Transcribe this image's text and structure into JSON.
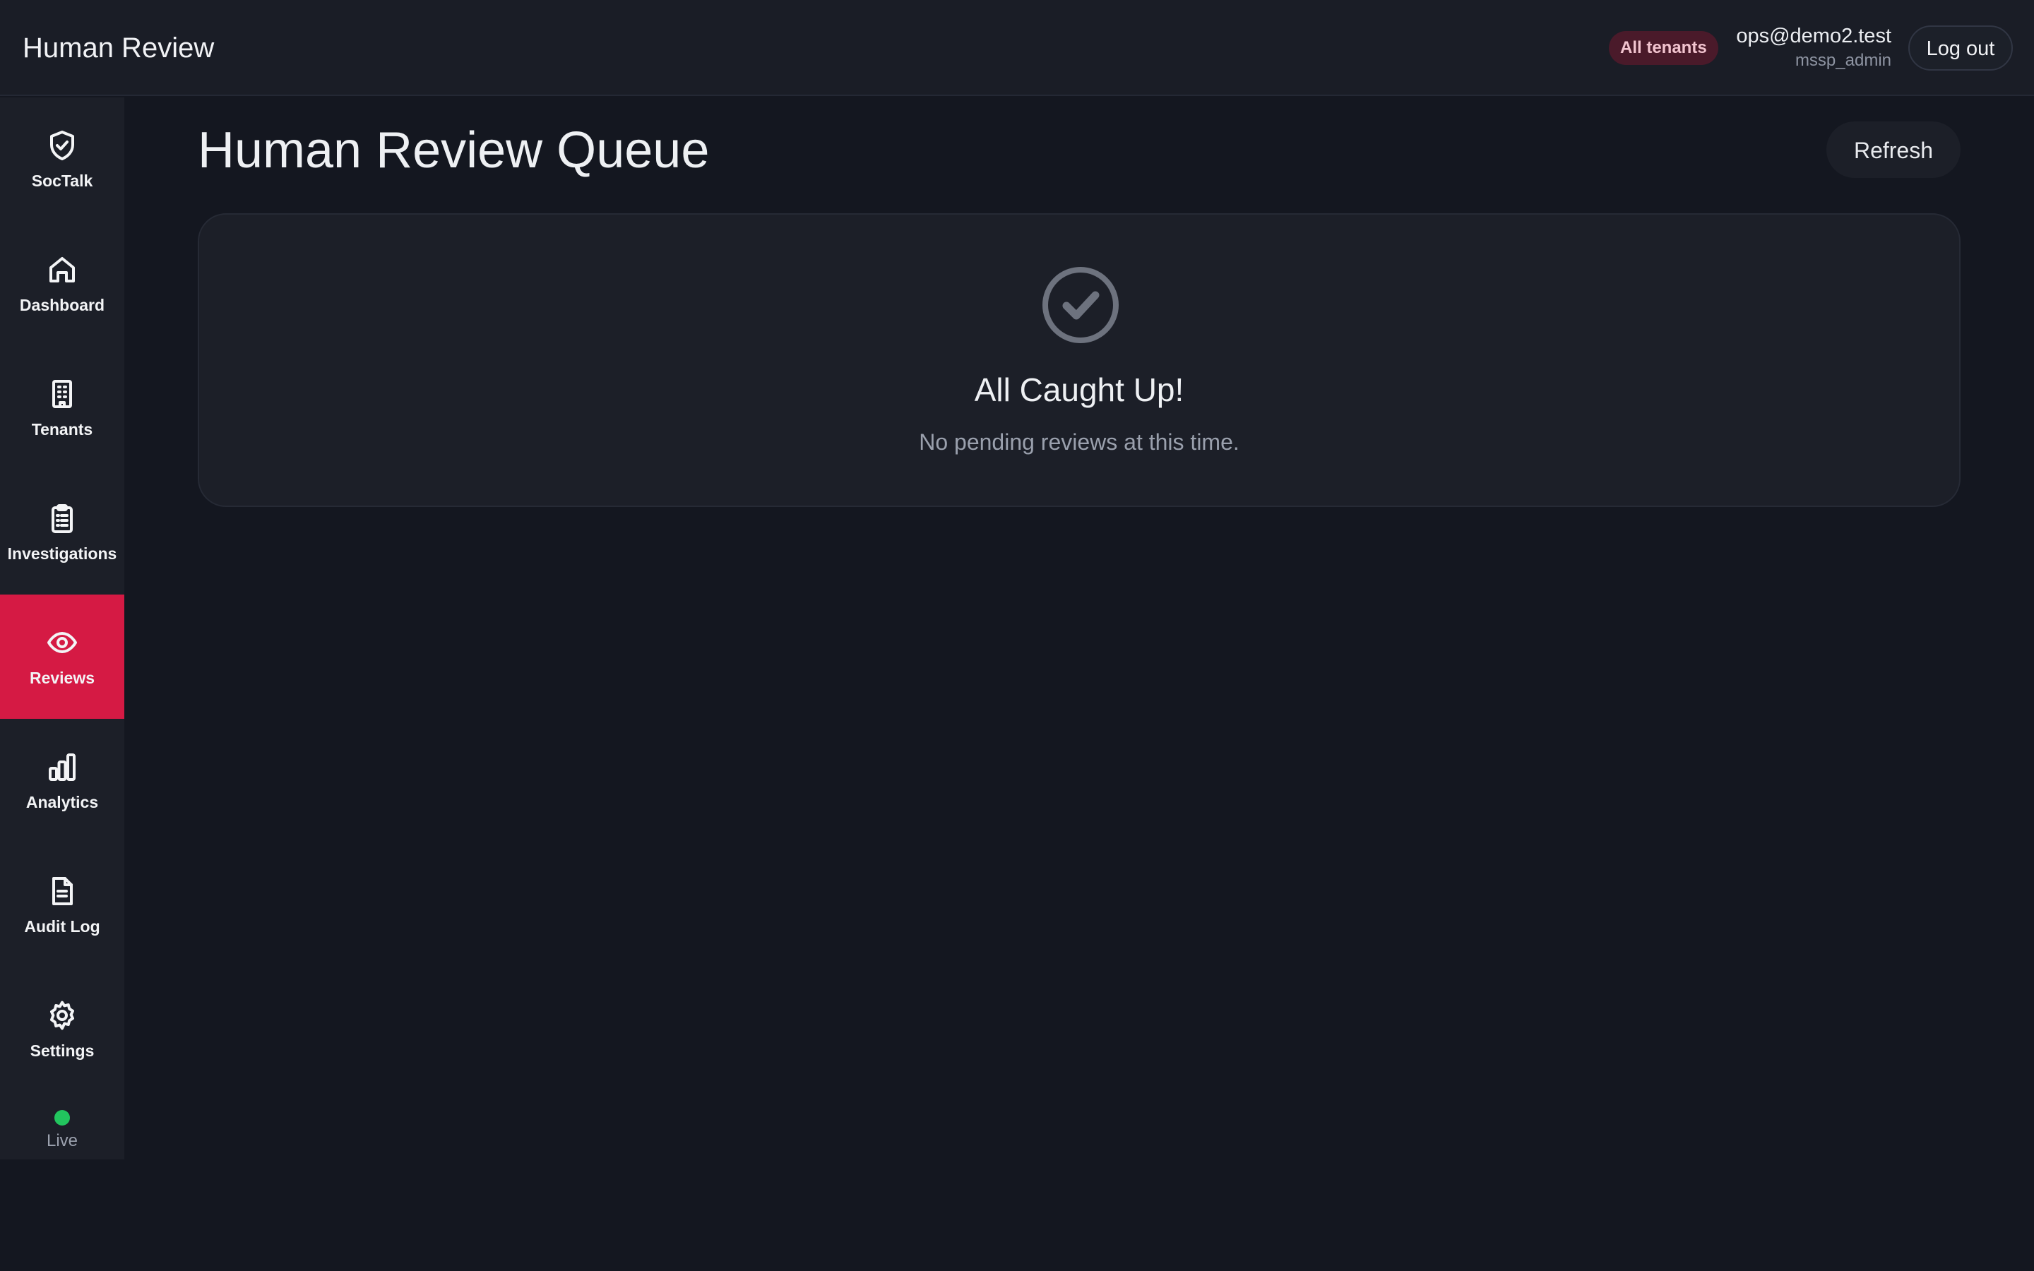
{
  "header": {
    "title": "Human Review",
    "tenant_badge": "All tenants",
    "user_email": "ops@demo2.test",
    "user_role": "mssp_admin",
    "logout_label": "Log out"
  },
  "sidebar": {
    "items": [
      {
        "label": "SocTalk",
        "icon": "shield-check-icon",
        "active": false
      },
      {
        "label": "Dashboard",
        "icon": "home-icon",
        "active": false
      },
      {
        "label": "Tenants",
        "icon": "building-icon",
        "active": false
      },
      {
        "label": "Investigations",
        "icon": "clipboard-list-icon",
        "active": false
      },
      {
        "label": "Reviews",
        "icon": "eye-icon",
        "active": true
      },
      {
        "label": "Analytics",
        "icon": "bar-chart-icon",
        "active": false
      },
      {
        "label": "Audit Log",
        "icon": "document-icon",
        "active": false
      },
      {
        "label": "Settings",
        "icon": "gear-icon",
        "active": false
      }
    ],
    "status": {
      "label": "Live",
      "color": "#22c55e"
    }
  },
  "main": {
    "page_title": "Human Review Queue",
    "refresh_label": "Refresh",
    "empty_state": {
      "icon": "check-circle-icon",
      "title": "All Caught Up!",
      "subtitle": "No pending reviews at this time."
    }
  },
  "colors": {
    "accent": "#d51a44",
    "background": "#141720",
    "panel": "#1c1f28",
    "status_live": "#22c55e"
  }
}
